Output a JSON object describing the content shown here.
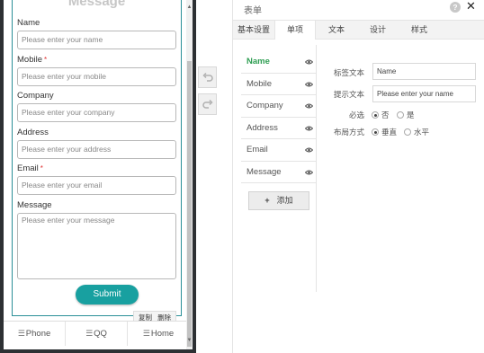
{
  "colors": {
    "accent": "#18a0a0",
    "frame": "#2a8f97",
    "active_field": "#2e9e52",
    "required": "#e03030",
    "phone_bezel": "#2d3033"
  },
  "preview": {
    "form_title": "Message",
    "fields": [
      {
        "label": "Name",
        "required": false,
        "placeholder": "Please enter your name"
      },
      {
        "label": "Mobile",
        "required": true,
        "placeholder": "Please enter your mobile"
      },
      {
        "label": "Company",
        "required": false,
        "placeholder": "Please enter your company"
      },
      {
        "label": "Address",
        "required": false,
        "placeholder": "Please enter your address"
      },
      {
        "label": "Email",
        "required": true,
        "placeholder": "Please enter your email"
      }
    ],
    "message": {
      "label": "Message",
      "placeholder": "Please enter your message"
    },
    "required_mark": "*",
    "submit_label": "Submit",
    "copy_label": "复制",
    "delete_label": "删除",
    "nav": [
      {
        "icon": "menu-icon",
        "label": "Phone"
      },
      {
        "icon": "menu-icon",
        "label": "QQ"
      },
      {
        "icon": "menu-icon",
        "label": "Home"
      }
    ]
  },
  "toolbar": {
    "undo_icon": "undo-icon",
    "redo_icon": "redo-icon"
  },
  "panel": {
    "title": "表单",
    "tabs": [
      "基本设置",
      "单项",
      "文本",
      "设计",
      "样式"
    ],
    "active_tab": 1,
    "field_list": [
      "Name",
      "Mobile",
      "Company",
      "Address",
      "Email",
      "Message"
    ],
    "active_field": 0,
    "add_button": "添加",
    "props": {
      "label_text_label": "标签文本",
      "label_text_value": "Name",
      "hint_text_label": "提示文本",
      "hint_text_value": "Please enter your name",
      "required_label": "必选",
      "required_no": "否",
      "required_yes": "是",
      "required_selected": "否",
      "layout_label": "布局方式",
      "layout_vertical": "垂直",
      "layout_horizontal": "水平",
      "layout_selected": "垂直"
    }
  }
}
